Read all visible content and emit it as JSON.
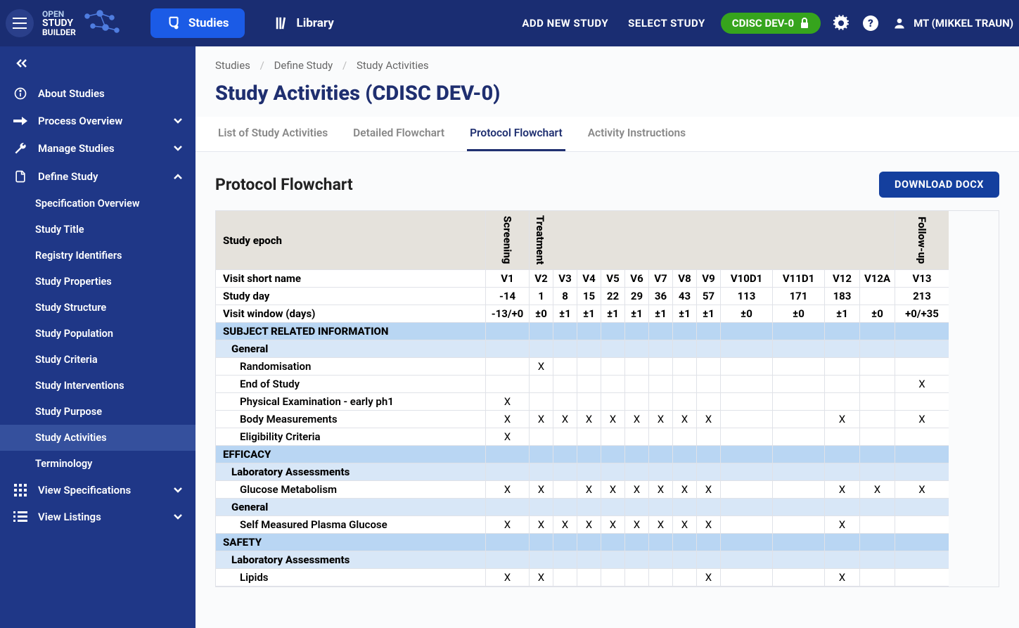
{
  "topbar": {
    "nav": {
      "studies": "Studies",
      "library": "Library"
    },
    "actions": {
      "add_study": "ADD NEW STUDY",
      "select_study": "SELECT STUDY"
    },
    "badge": "CDISC DEV-0",
    "user": "MT (MIKKEL TRAUN)"
  },
  "sidebar": {
    "items": [
      {
        "label": "About Studies"
      },
      {
        "label": "Process Overview"
      },
      {
        "label": "Manage Studies"
      },
      {
        "label": "Define Study"
      },
      {
        "label": "View Specifications"
      },
      {
        "label": "View Listings"
      }
    ],
    "define_study_sub": [
      "Specification Overview",
      "Study Title",
      "Registry Identifiers",
      "Study Properties",
      "Study Structure",
      "Study Population",
      "Study Criteria",
      "Study Interventions",
      "Study Purpose",
      "Study Activities",
      "Terminology"
    ]
  },
  "breadcrumbs": [
    "Studies",
    "Define Study",
    "Study Activities"
  ],
  "page_title": "Study Activities (CDISC DEV-0)",
  "tabs": [
    "List of Study Activities",
    "Detailed Flowchart",
    "Protocol Flowchart",
    "Activity Instructions"
  ],
  "section": {
    "title": "Protocol Flowchart",
    "download": "DOWNLOAD DOCX"
  },
  "table": {
    "headers": {
      "epoch_label": "Study epoch",
      "visit_label": "Visit short name",
      "day_label": "Study day",
      "window_label": "Visit window (days)",
      "epochs": [
        "Screening",
        "Treatment",
        "Follow-up"
      ],
      "visits": [
        "V1",
        "V2",
        "V3",
        "V4",
        "V5",
        "V6",
        "V7",
        "V8",
        "V9",
        "V10D1",
        "V11D1",
        "V12",
        "V12A",
        "V13"
      ],
      "days": [
        "-14",
        "1",
        "8",
        "15",
        "22",
        "29",
        "36",
        "43",
        "57",
        "113",
        "171",
        "183",
        "",
        "213"
      ],
      "window": [
        "-13/+0",
        "±0",
        "±1",
        "±1",
        "±1",
        "±1",
        "±1",
        "±1",
        "±1",
        "±0",
        "±0",
        "±1",
        "±0",
        "+0/+35"
      ]
    },
    "rows": [
      {
        "type": "section",
        "label": "SUBJECT RELATED INFORMATION"
      },
      {
        "type": "group",
        "label": "General"
      },
      {
        "type": "activity",
        "label": "Randomisation",
        "x": [
          "",
          "X",
          "",
          "",
          "",
          "",
          "",
          "",
          "",
          "",
          "",
          "",
          "",
          ""
        ]
      },
      {
        "type": "activity",
        "label": "End of Study",
        "x": [
          "",
          "",
          "",
          "",
          "",
          "",
          "",
          "",
          "",
          "",
          "",
          "",
          "",
          "X"
        ]
      },
      {
        "type": "activity",
        "label": "Physical Examination - early ph1",
        "x": [
          "X",
          "",
          "",
          "",
          "",
          "",
          "",
          "",
          "",
          "",
          "",
          "",
          "",
          ""
        ]
      },
      {
        "type": "activity",
        "label": "Body Measurements",
        "x": [
          "X",
          "X",
          "X",
          "X",
          "X",
          "X",
          "X",
          "X",
          "X",
          "",
          "",
          "X",
          "",
          "X"
        ]
      },
      {
        "type": "activity",
        "label": "Eligibility Criteria",
        "x": [
          "X",
          "",
          "",
          "",
          "",
          "",
          "",
          "",
          "",
          "",
          "",
          "",
          "",
          ""
        ]
      },
      {
        "type": "section",
        "label": "EFFICACY"
      },
      {
        "type": "group",
        "label": "Laboratory Assessments"
      },
      {
        "type": "activity",
        "label": "Glucose Metabolism",
        "x": [
          "X",
          "X",
          "",
          "X",
          "X",
          "X",
          "X",
          "X",
          "X",
          "",
          "",
          "X",
          "X",
          "X"
        ]
      },
      {
        "type": "group",
        "label": "General"
      },
      {
        "type": "activity",
        "label": "Self Measured Plasma Glucose",
        "x": [
          "X",
          "X",
          "X",
          "X",
          "X",
          "X",
          "X",
          "X",
          "X",
          "",
          "",
          "X",
          "",
          ""
        ]
      },
      {
        "type": "section",
        "label": "SAFETY"
      },
      {
        "type": "group",
        "label": "Laboratory Assessments"
      },
      {
        "type": "activity",
        "label": "Lipids",
        "x": [
          "X",
          "X",
          "",
          "",
          "",
          "",
          "",
          "",
          "X",
          "",
          "",
          "X",
          "",
          ""
        ]
      }
    ]
  }
}
